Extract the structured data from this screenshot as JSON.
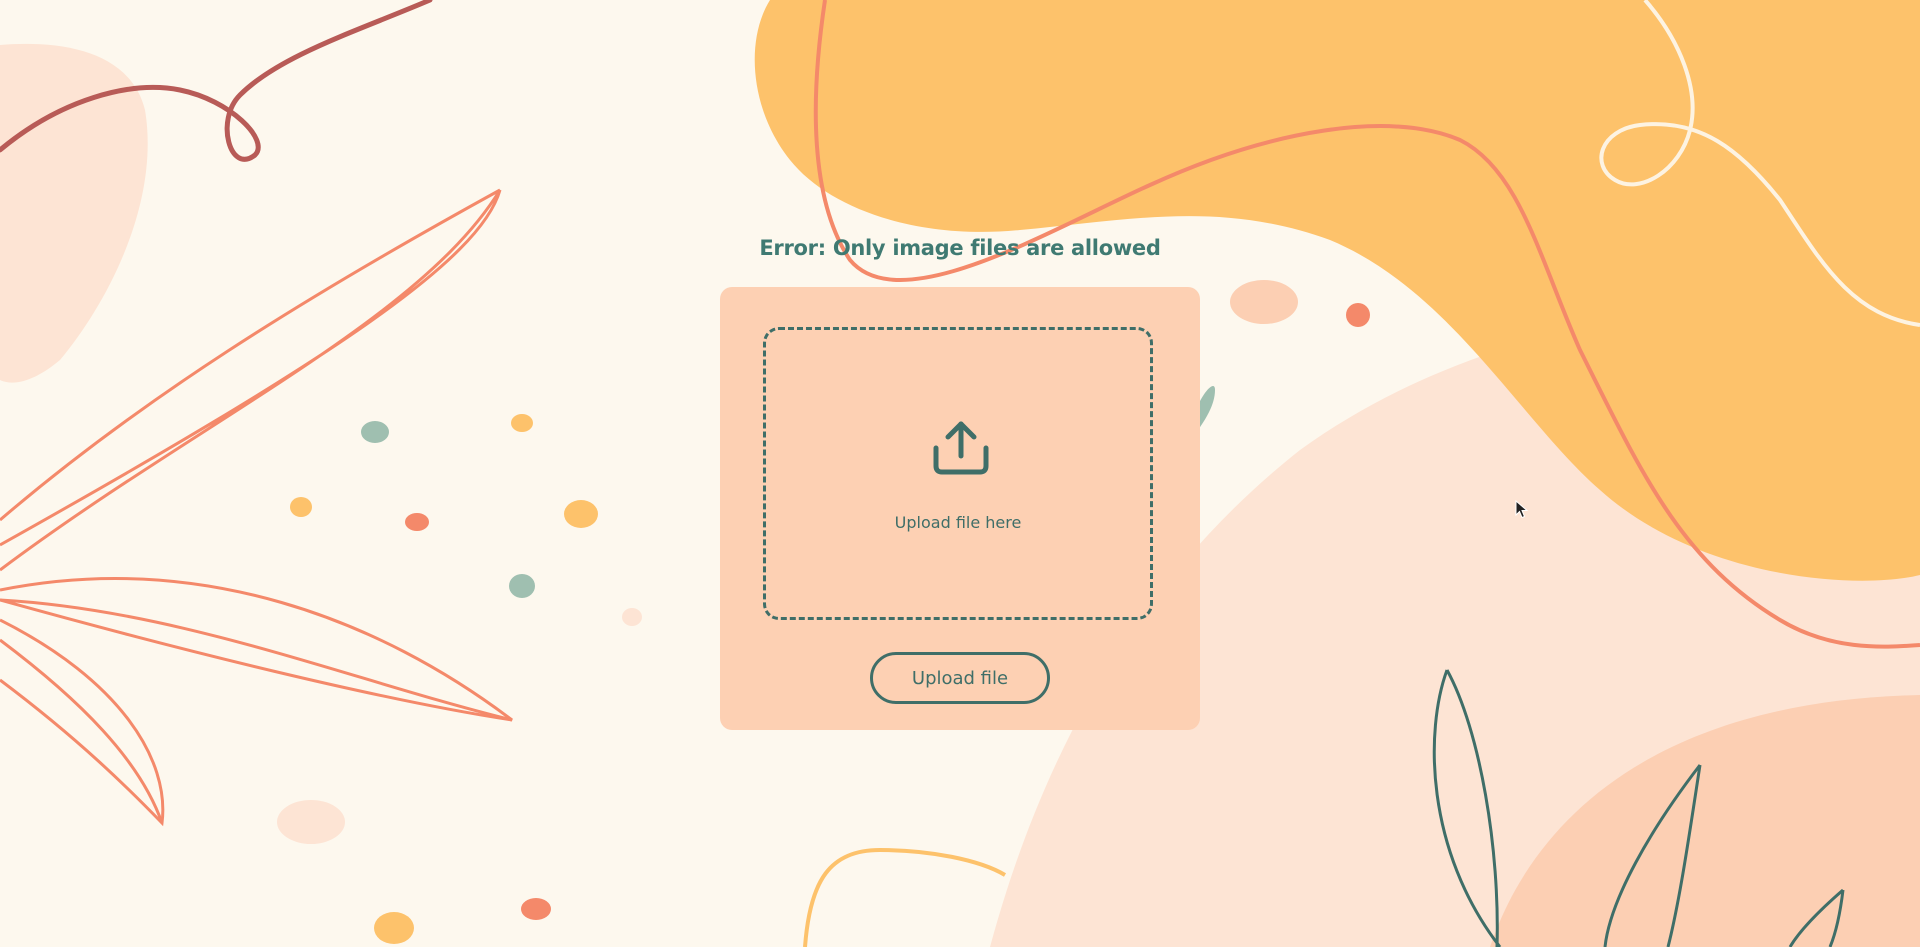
{
  "error": {
    "message": "Error: Only image files are allowed"
  },
  "upload": {
    "icon": "upload-icon",
    "drop_label": "Upload file here",
    "button_label": "Upload file"
  },
  "colors": {
    "background": "#fdf8ee",
    "card": "#fdd0b3",
    "accent": "#3f6e68",
    "orange_blob": "#fdc26b",
    "coral": "#f4896a"
  }
}
